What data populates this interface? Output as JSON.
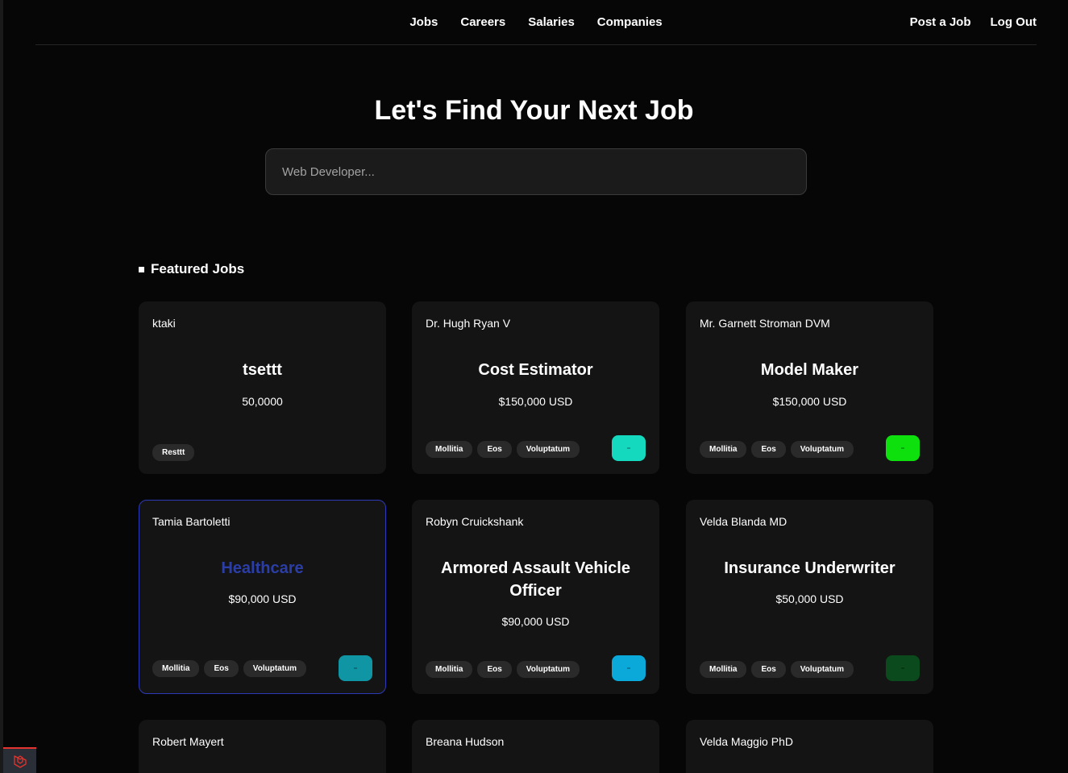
{
  "nav": {
    "links": [
      "Jobs",
      "Careers",
      "Salaries",
      "Companies"
    ],
    "right": [
      "Post a Job",
      "Log Out"
    ]
  },
  "hero": {
    "title": "Let's Find Your Next Job",
    "search_placeholder": "Web Developer..."
  },
  "section": {
    "title": "Featured Jobs"
  },
  "jobs": [
    {
      "employer": "ktaki",
      "title": "tsettt",
      "salary": "50,0000",
      "tags": [
        "Resttt"
      ],
      "logo_color": null
    },
    {
      "employer": "Dr. Hugh Ryan V",
      "title": "Cost Estimator",
      "salary": "$150,000 USD",
      "tags": [
        "Mollitia",
        "Eos",
        "Voluptatum"
      ],
      "logo_color": "#14d9bf"
    },
    {
      "employer": "Mr. Garnett Stroman DVM",
      "title": "Model Maker",
      "salary": "$150,000 USD",
      "tags": [
        "Mollitia",
        "Eos",
        "Voluptatum"
      ],
      "logo_color": "#0de00d"
    },
    {
      "employer": "Tamia Bartoletti",
      "title": "Healthcare",
      "salary": "$90,000 USD",
      "tags": [
        "Mollitia",
        "Eos",
        "Voluptatum"
      ],
      "logo_color": "#0f95a3"
    },
    {
      "employer": "Robyn Cruickshank",
      "title": "Armored Assault Vehicle Officer",
      "salary": "$90,000 USD",
      "tags": [
        "Mollitia",
        "Eos",
        "Voluptatum"
      ],
      "logo_color": "#0aa9d9"
    },
    {
      "employer": "Velda Blanda MD",
      "title": "Insurance Underwriter",
      "salary": "$50,000 USD",
      "tags": [
        "Mollitia",
        "Eos",
        "Voluptatum"
      ],
      "logo_color": "#0a4a1c"
    },
    {
      "employer": "Robert Mayert",
      "title": "",
      "salary": "",
      "tags": [],
      "logo_color": null
    },
    {
      "employer": "Breana Hudson",
      "title": "",
      "salary": "",
      "tags": [],
      "logo_color": null
    },
    {
      "employer": "Velda Maggio PhD",
      "title": "",
      "salary": "",
      "tags": [],
      "logo_color": null
    }
  ],
  "colors": {
    "highlight_border": "#2d3ab8",
    "highlight_title": "#2b3ea8",
    "laravel_red": "#e3342f"
  },
  "icons": {
    "laravel_badge": "laravel-icon"
  }
}
